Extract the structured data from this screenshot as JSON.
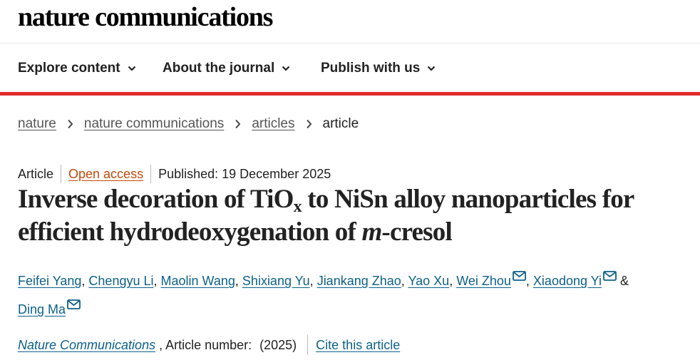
{
  "site": {
    "logo": "nature communications"
  },
  "nav": {
    "items": [
      {
        "label": "Explore content"
      },
      {
        "label": "About the journal"
      },
      {
        "label": "Publish with us"
      }
    ]
  },
  "breadcrumb": {
    "items": [
      "nature",
      "nature communications",
      "articles"
    ],
    "current": "article"
  },
  "meta": {
    "type": "Article",
    "access": "Open access",
    "published": "Published: 19 December 2025"
  },
  "title": {
    "part1": "Inverse decoration of TiO",
    "sub": "x",
    "part2": " to NiSn alloy nanoparticles for efficient hydrodeoxygenation of ",
    "italic": "m",
    "part3": "-cresol"
  },
  "authors": [
    "Feifei Yang",
    "Chengyu Li",
    "Maolin Wang",
    "Shixiang Yu",
    "Jiankang Zhao",
    "Yao Xu",
    "Wei Zhou",
    "Xiaodong Yi",
    "Ding Ma"
  ],
  "authors_connector": "&",
  "citation": {
    "journal": "Nature Communications",
    "article_number": ", Article number:",
    "year": "(2025)",
    "cite_label": "Cite this article"
  },
  "colors": {
    "accent_rule": "#e12c2c",
    "link": "#0c6189",
    "open_access": "#c2490a"
  }
}
